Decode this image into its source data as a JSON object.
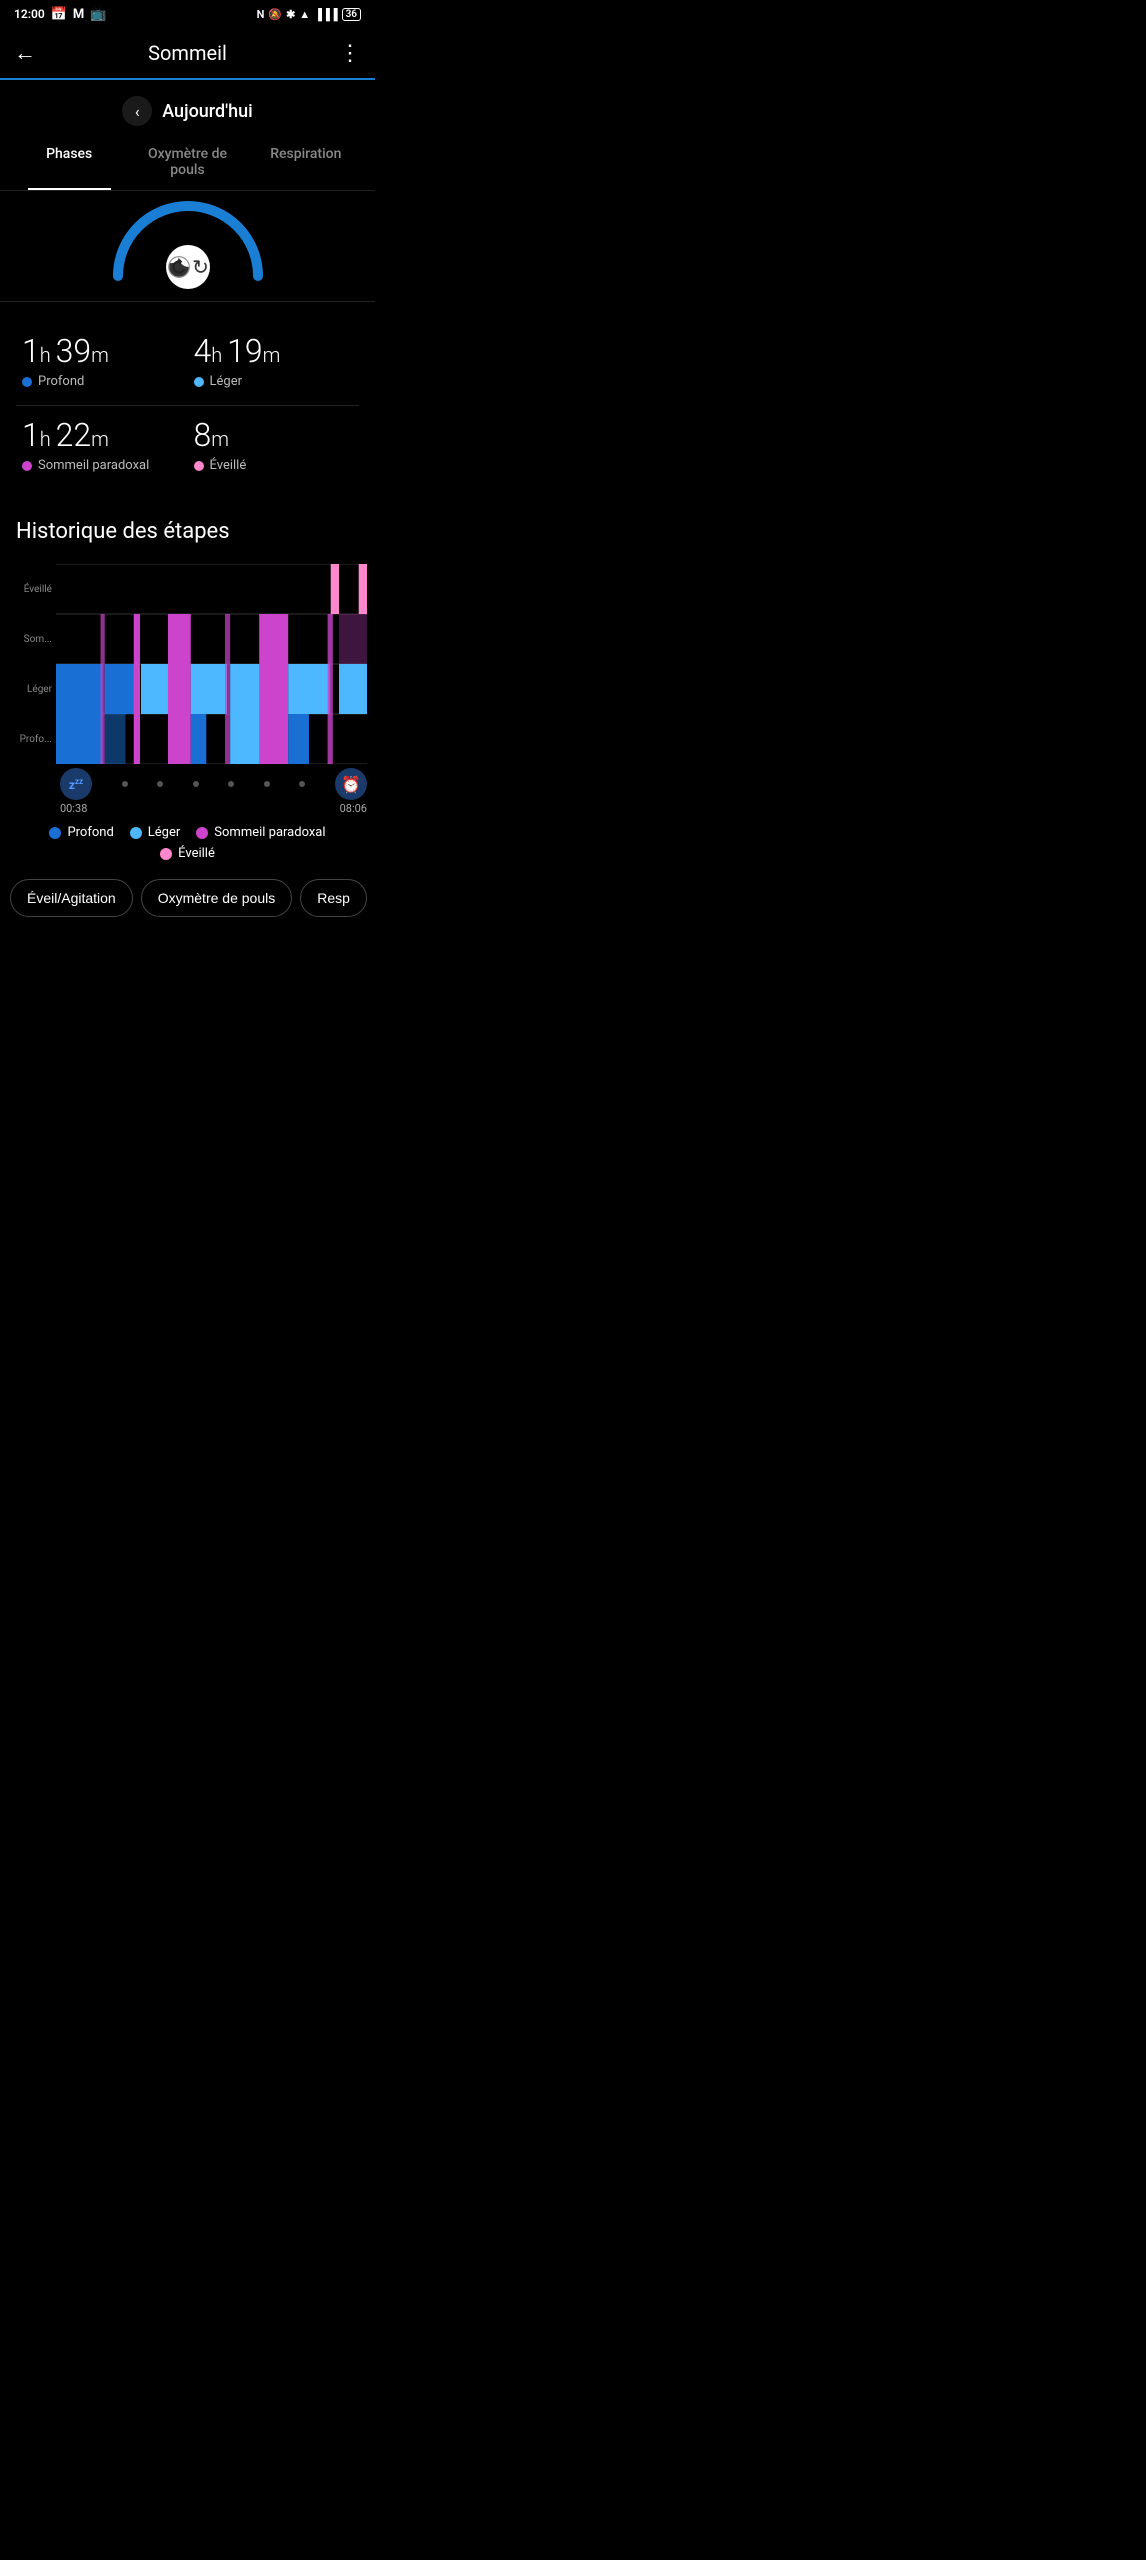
{
  "statusBar": {
    "time": "12:00",
    "batteryLevel": "36"
  },
  "header": {
    "title": "Sommeil",
    "backLabel": "←",
    "moreLabel": "⋮"
  },
  "datePicker": {
    "label": "Aujourd'hui",
    "chevronLeft": "‹"
  },
  "tabs": [
    {
      "id": "phases",
      "label": "Phases",
      "active": true
    },
    {
      "id": "oxymetre",
      "label": "Oxymètre de pouls",
      "active": false
    },
    {
      "id": "respiration",
      "label": "Respiration",
      "active": false
    }
  ],
  "sleepStats": [
    {
      "hours": "1",
      "unit": "h",
      "minutes": "39",
      "minuteUnit": "m",
      "label": "Profond",
      "color": "#1a6fd4"
    },
    {
      "hours": "4",
      "unit": "h",
      "minutes": "19",
      "minuteUnit": "m",
      "label": "Léger",
      "color": "#4db8ff"
    },
    {
      "hours": "1",
      "unit": "h",
      "minutes": "22",
      "minuteUnit": "m",
      "label": "Sommeil paradoxal",
      "color": "#cc44cc"
    },
    {
      "hours": "",
      "unit": "",
      "minutes": "8",
      "minuteUnit": "m",
      "label": "Éveillé",
      "color": "#ff88cc"
    }
  ],
  "historique": {
    "title": "Historique des étapes"
  },
  "chart": {
    "yLabels": [
      "Éveillé",
      "Som...",
      "Léger",
      "Profo..."
    ],
    "startTime": "00:38",
    "endTime": "08:06",
    "colors": {
      "profond": "#1a6fd4",
      "leger": "#4db8ff",
      "sommeilParadoxal": "#cc44cc",
      "eveille": "#ff88cc"
    }
  },
  "legend": [
    {
      "label": "Profond",
      "color": "#1a6fd4"
    },
    {
      "label": "Léger",
      "color": "#4db8ff"
    },
    {
      "label": "Sommeil paradoxal",
      "color": "#cc44cc"
    },
    {
      "label": "Éveillé",
      "color": "#ff88cc"
    }
  ],
  "bottomButtons": [
    {
      "label": "Éveil/Agitation"
    },
    {
      "label": "Oxymètre de pouls"
    },
    {
      "label": "Resp"
    }
  ]
}
